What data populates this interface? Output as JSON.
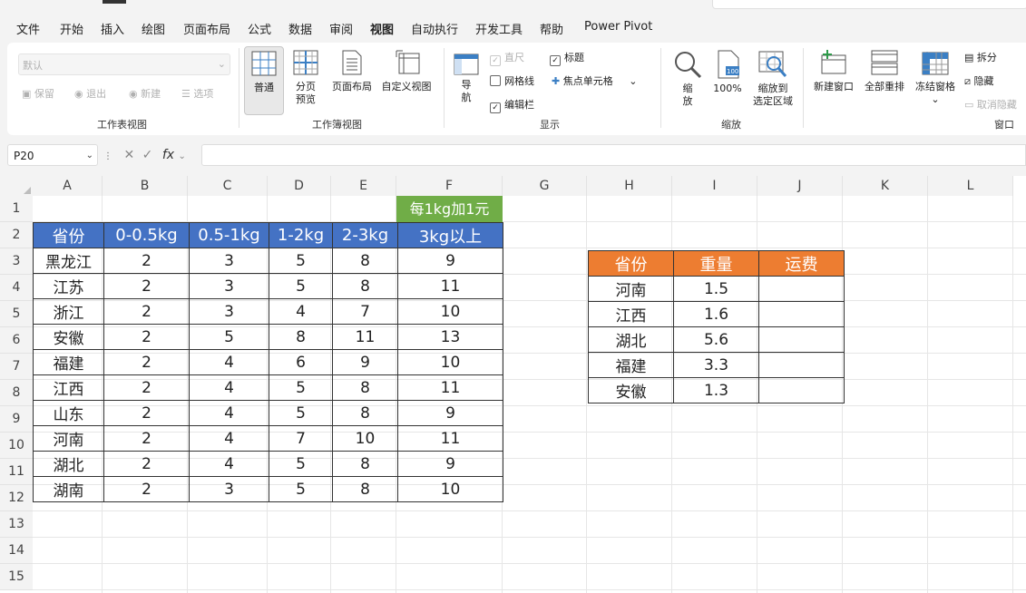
{
  "menu": {
    "items": [
      "文件",
      "开始",
      "插入",
      "绘图",
      "页面布局",
      "公式",
      "数据",
      "审阅",
      "视图",
      "自动执行",
      "开发工具",
      "帮助",
      "Power Pivot"
    ],
    "active": "视图"
  },
  "ribbon": {
    "sheet_view": {
      "dropdown_value": "默认",
      "keep": "保留",
      "exit": "退出",
      "new": "新建",
      "options": "选项",
      "label": "工作表视图"
    },
    "workbook_views": {
      "normal": "普通",
      "page_break_1": "分页",
      "page_break_2": "预览",
      "page_layout": "页面布局",
      "custom": "自定义视图",
      "label": "工作簿视图"
    },
    "show": {
      "navigation_1": "导",
      "navigation_2": "航",
      "ruler": "直尺",
      "gridlines": "网格线",
      "formula_bar": "编辑栏",
      "headings": "标题",
      "focus_cell": "焦点单元格",
      "label": "显示",
      "ruler_checked": true,
      "gridlines_checked": false,
      "formula_bar_checked": true,
      "headings_checked": true
    },
    "zoom": {
      "zoom_1": "缩",
      "zoom_2": "放",
      "hundred": "100%",
      "to_selection_1": "缩放到",
      "to_selection_2": "选定区域",
      "label": "缩放"
    },
    "window": {
      "new_window": "新建窗口",
      "arrange_all": "全部重排",
      "freeze_panes": "冻结窗格",
      "split": "拆分",
      "hide": "隐藏",
      "unhide": "取消隐藏",
      "label": "窗口"
    }
  },
  "formula_bar": {
    "name_box": "P20",
    "fx": "fx",
    "formula": ""
  },
  "sheet": {
    "columns": [
      "A",
      "B",
      "C",
      "D",
      "E",
      "F",
      "G",
      "H",
      "I",
      "J",
      "K",
      "L"
    ],
    "rows": [
      "1",
      "2",
      "3",
      "4",
      "5",
      "6",
      "7",
      "8",
      "9",
      "10",
      "11",
      "12",
      "13",
      "14",
      "15"
    ],
    "note": "每1kg加1元",
    "rate_table": {
      "headers": [
        "省份",
        "0-0.5kg",
        "0.5-1kg",
        "1-2kg",
        "2-3kg",
        "3kg以上"
      ],
      "rows": [
        [
          "黑龙江",
          "2",
          "3",
          "5",
          "8",
          "9"
        ],
        [
          "江苏",
          "2",
          "3",
          "5",
          "8",
          "11"
        ],
        [
          "浙江",
          "2",
          "3",
          "4",
          "7",
          "10"
        ],
        [
          "安徽",
          "2",
          "5",
          "8",
          "11",
          "13"
        ],
        [
          "福建",
          "2",
          "4",
          "6",
          "9",
          "10"
        ],
        [
          "江西",
          "2",
          "4",
          "5",
          "8",
          "11"
        ],
        [
          "山东",
          "2",
          "4",
          "5",
          "8",
          "9"
        ],
        [
          "河南",
          "2",
          "4",
          "7",
          "10",
          "11"
        ],
        [
          "湖北",
          "2",
          "4",
          "5",
          "8",
          "9"
        ],
        [
          "湖南",
          "2",
          "3",
          "5",
          "8",
          "10"
        ]
      ]
    },
    "query_table": {
      "headers": [
        "省份",
        "重量",
        "运费"
      ],
      "rows": [
        [
          "河南",
          "1.5",
          ""
        ],
        [
          "江西",
          "1.6",
          ""
        ],
        [
          "湖北",
          "5.6",
          ""
        ],
        [
          "福建",
          "3.3",
          ""
        ],
        [
          "安徽",
          "1.3",
          ""
        ]
      ]
    }
  },
  "colors": {
    "accent": "#217346",
    "rate_header": "#4472c4",
    "note_bg": "#70ad47",
    "query_header": "#ed7d31"
  }
}
